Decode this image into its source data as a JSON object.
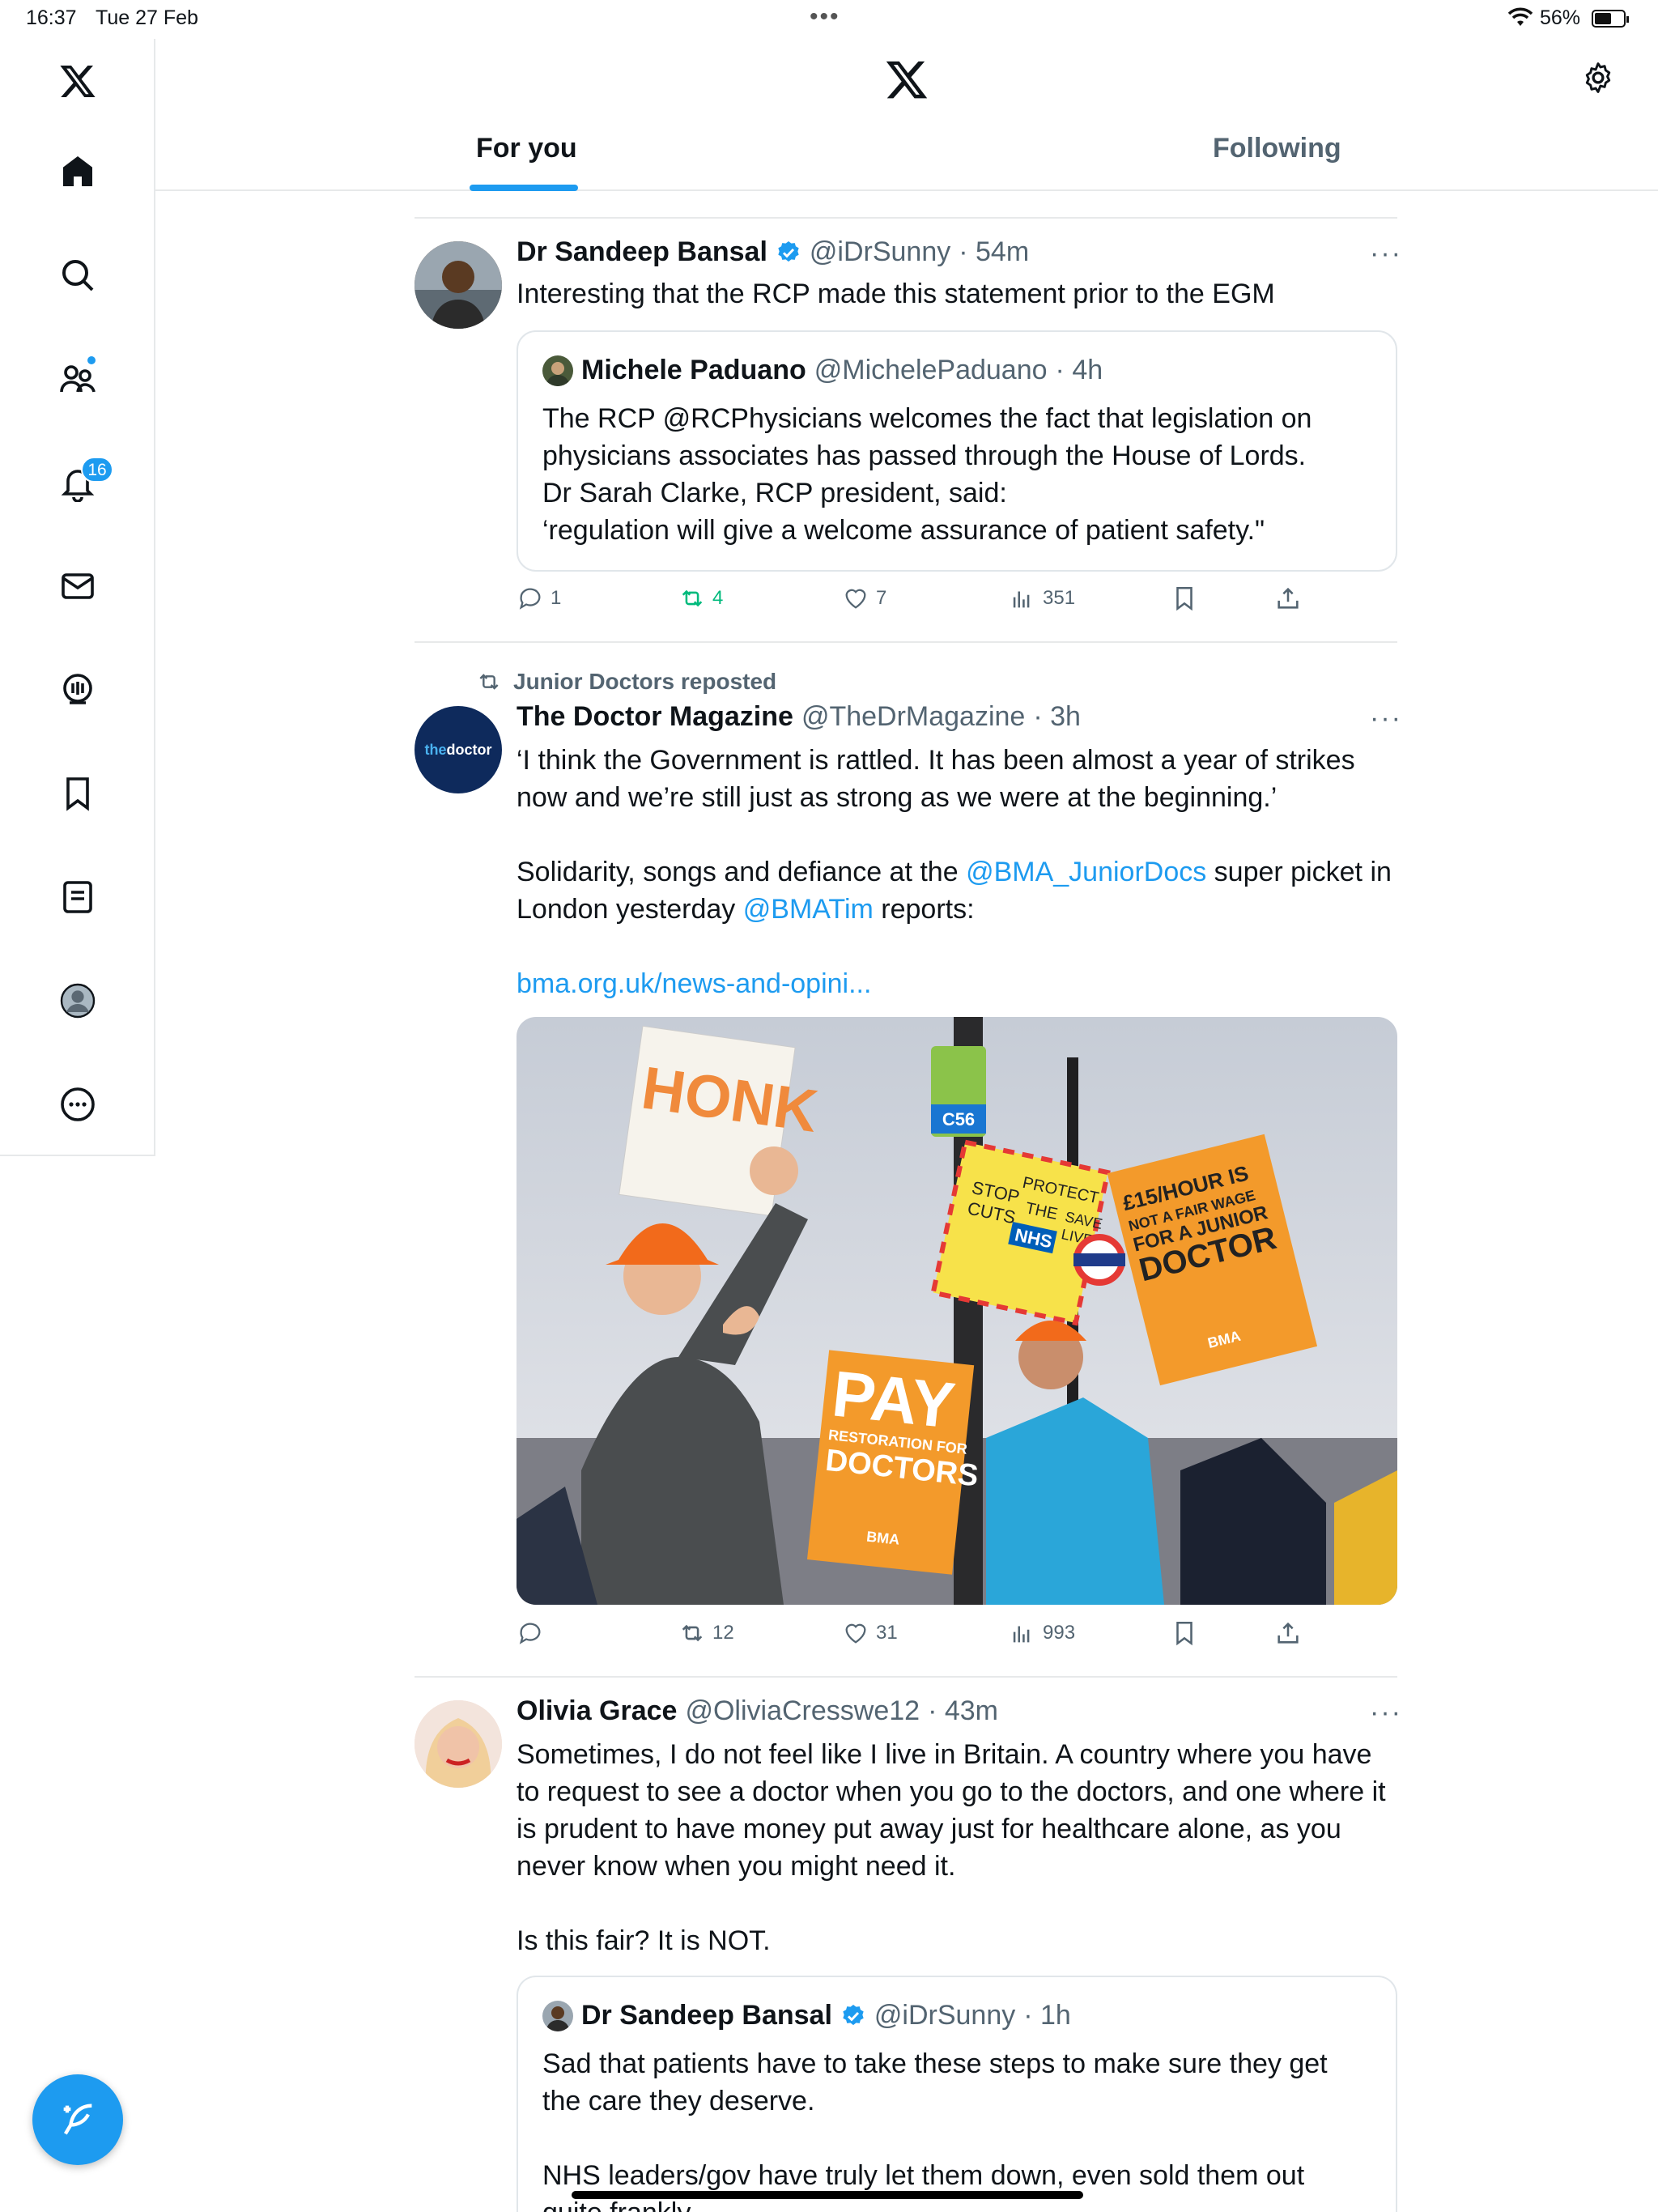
{
  "status_bar": {
    "time": "16:37",
    "date": "Tue 27 Feb",
    "dots": "•••",
    "battery": "56%"
  },
  "sidebar": {
    "items": [
      "home",
      "search",
      "communities",
      "notifications",
      "messages",
      "spaces",
      "bookmarks",
      "lists",
      "profile",
      "more"
    ],
    "notifications_badge": "16"
  },
  "topbar": {
    "tabs": [
      "For you",
      "Following"
    ],
    "active_tab": "For you"
  },
  "posts": [
    {
      "name": "Dr Sandeep Bansal",
      "handle": "@iDrSunny",
      "time": "· 54m",
      "text": "Interesting that the RCP made this statement prior to the EGM",
      "quote": {
        "name": "Michele Paduano",
        "handle": "@MichelePaduano",
        "time": "· 4h",
        "lines": [
          "The RCP @RCPhysicians welcomes the fact that legislation on",
          "physicians associates has passed through the House of Lords.",
          "Dr Sarah Clarke, RCP president, said:",
          "‘regulation will give a welcome assurance of patient safety.\""
        ]
      },
      "stats": {
        "replies": "1",
        "reposts": "4",
        "likes": "7",
        "views": "351"
      }
    },
    {
      "repost_label": "Junior Doctors reposted",
      "name": "The Doctor Magazine",
      "handle": "@TheDrMagazine",
      "time": "· 3h",
      "avatar_text_a": "the",
      "avatar_text_b": "doctor",
      "line1": "‘I think the Government is rattled. It has been almost a year of strikes",
      "line2": "now and we’re still just as strong as we were at the beginning.’",
      "line3_a": "Solidarity, songs and defiance at the ",
      "line3_link": "@BMA_JuniorDocs",
      "line3_b": " super picket in",
      "line4_a": "London yesterday ",
      "line4_link": "@BMATim",
      "line4_b": " reports:",
      "url": "bma.org.uk/news-and-opini...",
      "photo_signs": {
        "honk": "HONK",
        "pay": "PAY",
        "restoration": "RESTORATION FOR",
        "doctors": "DOCTORS",
        "bma": "BMA",
        "wage1": "£15/HOUR IS",
        "wage2": "NOT A FAIR WAGE",
        "wage3": "FOR A JUNIOR",
        "wage4": "DOCTOR",
        "protect1": "STOP",
        "protect2": "CUTS",
        "protect3": "PROTECT",
        "protect4": "THE",
        "protect5": "NHS",
        "protect6": "SAVE",
        "protect7": "LIVES",
        "route": "C56"
      },
      "stats": {
        "replies": "",
        "reposts": "12",
        "likes": "31",
        "views": "993"
      }
    },
    {
      "name": "Olivia Grace",
      "handle": "@OliviaCresswe12",
      "time": "· 43m",
      "lines": [
        "Sometimes, I do not feel like I live in Britain. A country where you have",
        "to request to see a doctor when you go to the doctors, and one where it",
        "is prudent to have money put away just for healthcare alone, as you",
        "never know when you might need it."
      ],
      "line_after": "Is this fair? It is NOT.",
      "quote": {
        "name": "Dr Sandeep Bansal",
        "handle": "@iDrSunny",
        "time": "· 1h",
        "lines": [
          "Sad that patients have to take these steps to make sure they get",
          "the care they deserve."
        ],
        "line_after": "NHS leaders/gov have truly let them down, even sold them out",
        "line_cut": "quite frankly"
      }
    }
  ],
  "colors": {
    "accent": "#1d9bf0",
    "repost_green": "#00ba7c",
    "muted": "#536471"
  }
}
